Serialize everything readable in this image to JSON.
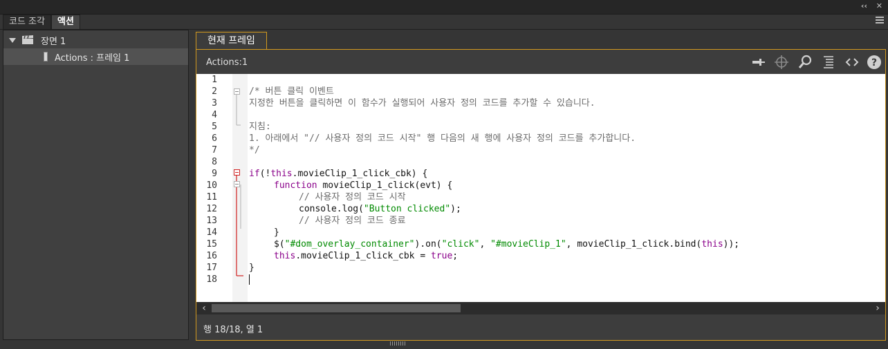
{
  "window": {
    "collapse_label": "‹‹",
    "close_label": "✕"
  },
  "panel_tabs": [
    {
      "label": "코드 조각"
    },
    {
      "label": "액션"
    }
  ],
  "tree": {
    "scene_label": "장면 1",
    "frame_label": "Actions : 프레임 1"
  },
  "editor": {
    "frame_tab": "현재 프레임",
    "actions_label": "Actions:1",
    "toolbar_icons": [
      "pin-icon",
      "target-icon",
      "find-icon",
      "format-icon",
      "code-icon",
      "help-icon"
    ],
    "line_numbers": [
      "1",
      "2",
      "3",
      "4",
      "5",
      "6",
      "7",
      "8",
      "9",
      "10",
      "11",
      "12",
      "13",
      "14",
      "15",
      "16",
      "17",
      "18"
    ],
    "lines": {
      "l2": "/* 버튼 클릭 이벤트",
      "l3": "지정한 버튼을 클릭하면 이 함수가 실행되어 사용자 정의 코드를 추가할 수 있습니다.",
      "l5": "지침:",
      "l6": "1. 아래에서 \"// 사용자 정의 코드 시작\" 행 다음의 새 행에 사용자 정의 코드를 추가합니다.",
      "l7": "*/",
      "l9_kw1": "if",
      "l9_a": "(!",
      "l9_kw2": "this",
      "l9_b": ".movieClip_1_click_cbk) {",
      "l10_kw": "function",
      "l10_b": " movieClip_1_click(evt) {",
      "l11": "// 사용자 정의 코드 시작",
      "l12_a": "console.log(",
      "l12_str": "\"Button clicked\"",
      "l12_b": ");",
      "l13": "// 사용자 정의 코드 종료",
      "l14": "}",
      "l15_a": "$(",
      "l15_s1": "\"#dom_overlay_container\"",
      "l15_b": ").on(",
      "l15_s2": "\"click\"",
      "l15_c": ", ",
      "l15_s3": "\"#movieClip_1\"",
      "l15_d": ", movieClip_1_click.bind(",
      "l15_kw": "this",
      "l15_e": "));",
      "l16_kw": "this",
      "l16_b": ".movieClip_1_click_cbk = ",
      "l16_kw2": "true",
      "l16_c": ";",
      "l17": "}"
    },
    "status": "행 18/18, 열 1"
  },
  "colors": {
    "accent": "#d49a1e",
    "keyword": "#8a008a",
    "string": "#008a00",
    "comment": "#6b6b6b"
  }
}
